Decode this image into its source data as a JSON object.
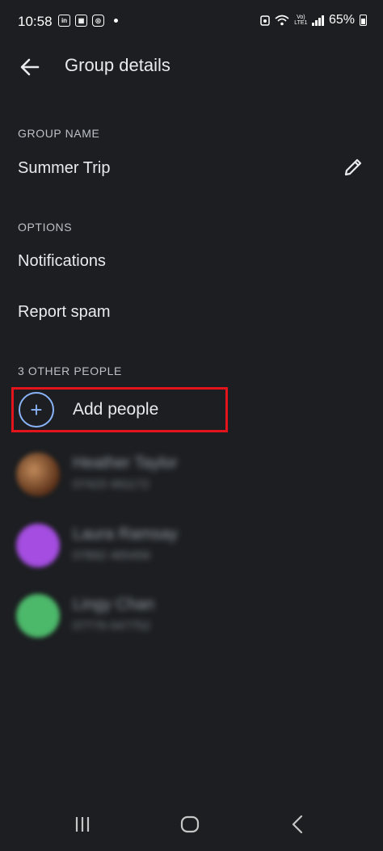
{
  "status_bar": {
    "time": "10:58",
    "icons_left": [
      "linkedin-icon",
      "calendar-icon",
      "instagram-icon",
      "notification-dot-icon"
    ],
    "battery": "65%",
    "network_label_top": "Vo)",
    "network_label_bottom": "LTE1"
  },
  "app_bar": {
    "title": "Group details",
    "back_icon": "arrow-left-icon"
  },
  "group_name": {
    "header": "GROUP NAME",
    "value": "Summer Trip",
    "edit_icon": "pencil-icon"
  },
  "options": {
    "header": "OPTIONS",
    "items": [
      "Notifications",
      "Report spam"
    ]
  },
  "people": {
    "header": "3 OTHER PEOPLE",
    "add_label": "Add people",
    "add_icon": "plus-icon",
    "highlight_color": "#e3141b",
    "contacts": [
      {
        "name": "Heather Taylor",
        "phone": "07423 491172",
        "avatar_color": "#7a4a2a"
      },
      {
        "name": "Laura Ramsay",
        "phone": "07892 465456",
        "avatar_color": "#a44de0"
      },
      {
        "name": "Lingy Chan",
        "phone": "07776 047752",
        "avatar_color": "#4cb86a"
      }
    ]
  },
  "nav_bar": {
    "icons": [
      "recents-icon",
      "home-icon",
      "back-icon"
    ]
  },
  "colors": {
    "background": "#1c1e21",
    "accent": "#8ab4f8",
    "text": "#e8eaed"
  }
}
